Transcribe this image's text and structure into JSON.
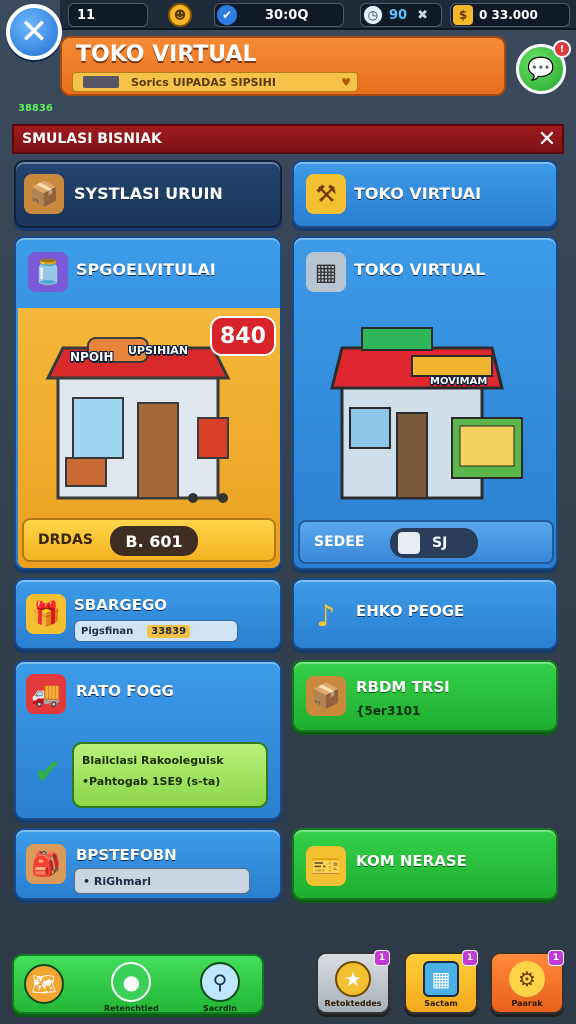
{
  "top_bar": {
    "level": "11",
    "shield_value": "30:0Q",
    "gems": "90",
    "coins": "0 33.000"
  },
  "title_banner": {
    "title": "TOKO VIRTUAL",
    "subtitle": "Sorics UIPADAS SIPSIHI"
  },
  "tiny_label": "38836",
  "section": {
    "title": "SMULASI BISNIAK"
  },
  "cards": {
    "systlasi": "SYSTLASI URUIN",
    "toko_virtual_top": "TOKO VIRTUAI",
    "spgoelvitulai": "SPGOELVITULAI",
    "toko_virtual_second": "TOKO VIRTUAL",
    "shop_left": {
      "sign": "UPSIHIAN",
      "roof_sign": "NPOIH",
      "price_tag": "840",
      "footer_label": "DRDAS",
      "footer_value": "B. 601"
    },
    "shop_right": {
      "sign": "MOVIMAM",
      "footer_label": "SEDEE",
      "footer_value": "SJ"
    },
    "sbargego": {
      "label": "SBARGEGO",
      "pill_text": "Pigsfinan",
      "pill_value": "33839"
    },
    "ehko_peoge": "EHKO PEOGE",
    "rato_fogg": "RATO FOGG",
    "rbdm_trsi": {
      "label": "RBDM TRSI",
      "sub": "{5er3101"
    },
    "info_box": {
      "line1": "Blailclasi Rakooleguisk",
      "line2": "•Pahtogab 1SE9 (s-ta)"
    },
    "bpstefobn": {
      "label": "BPSTEFOBN",
      "field": "• RiGhmarl"
    },
    "kom_nerase": "KOM NERASE"
  },
  "bottom_bar": {
    "left_caption_1": "Retenchtied",
    "left_caption_2": "Sacrdin",
    "btn1_caption": "Retokteddes",
    "btn2_caption": "Sactam",
    "btn3_caption": "Paarak",
    "btn1_badge": "1",
    "btn2_badge": "1",
    "btn3_badge": "1"
  }
}
